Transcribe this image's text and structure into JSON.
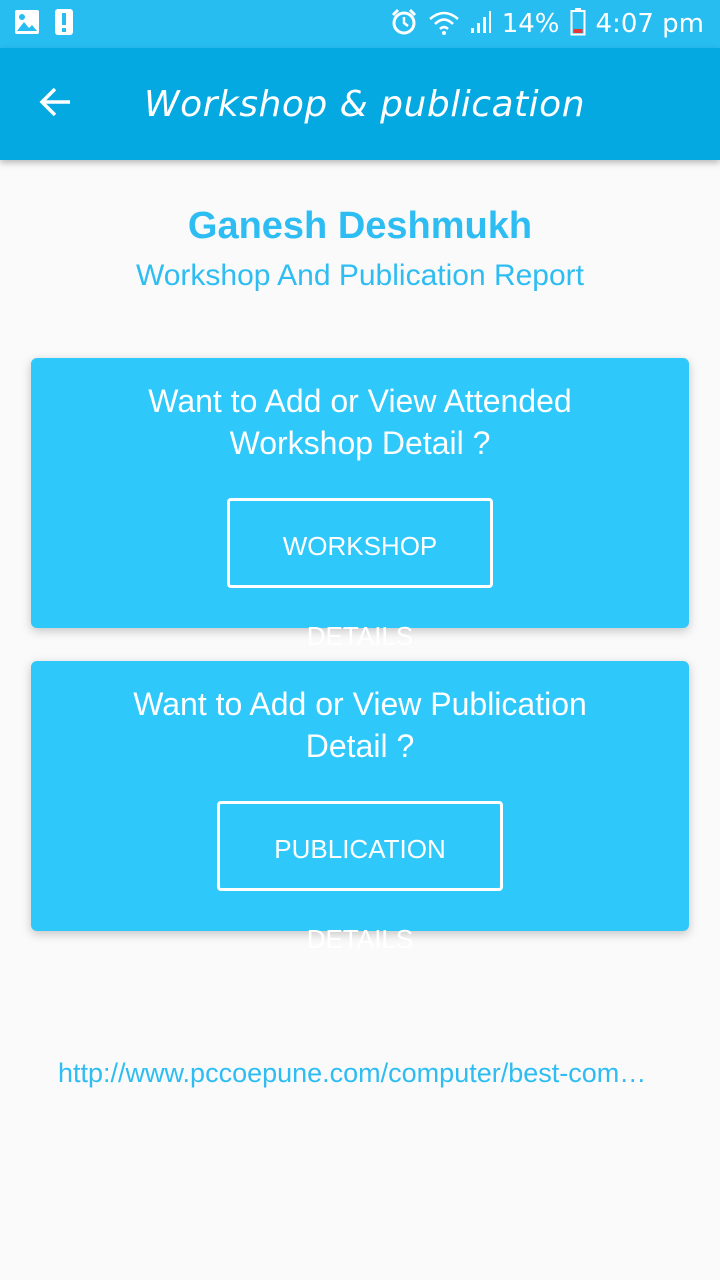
{
  "status_bar": {
    "icons_left": [
      "image-icon",
      "alert-icon"
    ],
    "icons_right": [
      "alarm-icon",
      "wifi-icon",
      "signal-icon"
    ],
    "battery_text": "14%",
    "time": "4:07 pm"
  },
  "app_bar": {
    "back_icon": "arrow-left-icon",
    "title": "Workshop & publication"
  },
  "header": {
    "name": "Ganesh Deshmukh",
    "subtitle": "Workshop And Publication Report"
  },
  "cards": [
    {
      "question": "Want to Add or View Attended Workshop Detail ?",
      "button_label": "WORKSHOP DETAILS"
    },
    {
      "question": "Want to Add or View Publication Detail ?",
      "button_label": "PUBLICATION DETAILS"
    }
  ],
  "footer_link": "http://www.pccoepune.com/computer/best-com…",
  "colors": {
    "status_bar": "#27bdf1",
    "app_bar": "#03a9e0",
    "card": "#2ec8fb",
    "accent_text": "#2ebdf2",
    "background": "#fafafa"
  }
}
